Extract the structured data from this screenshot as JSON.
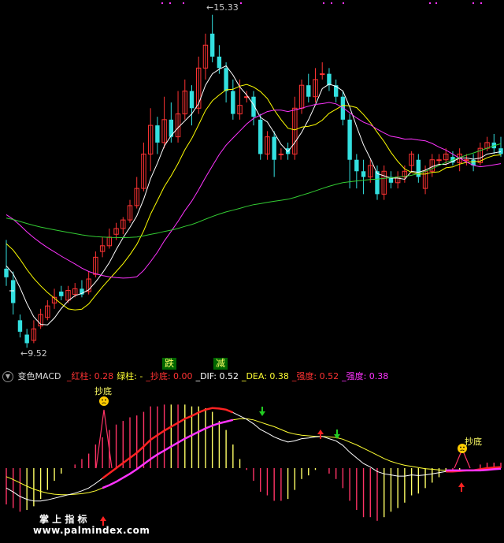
{
  "main_chart": {
    "price_high_label": "15.33",
    "price_low_label": "9.52",
    "signal_die": "跌",
    "signal_jian": "减"
  },
  "macd_panel": {
    "toggle_icon": "chevron-down-icon",
    "name": "变色MACD",
    "legend": [
      {
        "text": "_红柱: 0.28",
        "color": "#ff3333"
      },
      {
        "text": "绿柱: -",
        "color": "#ffff33"
      },
      {
        "text": "_抄底: 0.00",
        "color": "#ff3333"
      },
      {
        "text": "_DIF: 0.52",
        "color": "#ffffff"
      },
      {
        "text": "_DEA: 0.38",
        "color": "#ffff33"
      },
      {
        "text": "_强度: 0.52",
        "color": "#ff3333"
      },
      {
        "text": "_强度: 0.38",
        "color": "#ff33ff"
      }
    ],
    "chaodi_label_1": "抄底",
    "chaodi_label_2": "抄底",
    "watermark_title": "掌 上 指 标",
    "watermark_url": "www.palmindex.com"
  },
  "chart_data": {
    "type": "candlestick",
    "price_max": 15.33,
    "price_min": 9.52,
    "candles": [
      [
        10.9,
        10.75,
        11.4,
        10.6
      ],
      [
        10.7,
        10.3,
        10.85,
        10.1
      ],
      [
        10.0,
        9.8,
        10.1,
        9.7
      ],
      [
        9.75,
        9.6,
        9.85,
        9.52
      ],
      [
        9.65,
        9.85,
        10.0,
        9.6
      ],
      [
        9.9,
        10.1,
        10.2,
        9.85
      ],
      [
        10.05,
        10.25,
        10.35,
        10.0
      ],
      [
        10.3,
        10.4,
        10.55,
        10.2
      ],
      [
        10.5,
        10.42,
        10.6,
        10.35
      ],
      [
        10.35,
        10.52,
        10.6,
        10.3
      ],
      [
        10.45,
        10.55,
        10.65,
        10.4
      ],
      [
        10.55,
        10.45,
        10.7,
        10.4
      ],
      [
        10.5,
        10.72,
        10.85,
        10.45
      ],
      [
        10.8,
        11.1,
        11.2,
        10.75
      ],
      [
        11.2,
        11.3,
        11.45,
        11.1
      ],
      [
        11.3,
        11.45,
        11.6,
        11.25
      ],
      [
        11.5,
        11.6,
        11.7,
        11.4
      ],
      [
        11.6,
        11.75,
        11.8,
        11.5
      ],
      [
        11.75,
        12.0,
        12.1,
        11.7
      ],
      [
        12.0,
        12.3,
        12.5,
        11.95
      ],
      [
        12.3,
        12.9,
        13.1,
        12.25
      ],
      [
        12.9,
        13.4,
        13.7,
        12.6
      ],
      [
        13.4,
        13.1,
        13.55,
        12.9
      ],
      [
        13.1,
        13.5,
        13.9,
        13.0
      ],
      [
        13.5,
        13.2,
        13.8,
        13.1
      ],
      [
        13.2,
        13.6,
        14.0,
        13.1
      ],
      [
        13.6,
        14.0,
        14.2,
        13.5
      ],
      [
        14.0,
        13.7,
        14.1,
        13.4
      ],
      [
        13.7,
        14.4,
        14.6,
        13.6
      ],
      [
        14.4,
        14.8,
        15.0,
        14.2
      ],
      [
        15.0,
        14.6,
        15.33,
        14.5
      ],
      [
        14.6,
        14.4,
        14.8,
        14.3
      ],
      [
        14.4,
        14.0,
        14.5,
        13.8
      ],
      [
        14.0,
        13.6,
        14.2,
        13.5
      ],
      [
        13.6,
        13.75,
        14.2,
        13.5
      ],
      [
        13.9,
        13.9,
        14.0,
        13.8
      ],
      [
        13.9,
        13.55,
        14.0,
        13.4
      ],
      [
        13.5,
        12.9,
        13.6,
        12.8
      ],
      [
        12.9,
        13.2,
        13.3,
        12.8
      ],
      [
        13.2,
        12.8,
        13.3,
        12.5
      ],
      [
        12.9,
        12.9,
        13.0,
        12.8
      ],
      [
        13.0,
        12.9,
        13.1,
        12.8
      ],
      [
        12.9,
        13.7,
        13.9,
        12.8
      ],
      [
        13.7,
        14.1,
        14.2,
        13.6
      ],
      [
        14.1,
        13.9,
        14.3,
        13.8
      ],
      [
        13.9,
        14.2,
        14.4,
        13.8
      ],
      [
        14.3,
        14.3,
        14.5,
        14.2
      ],
      [
        14.3,
        14.1,
        14.4,
        14.0
      ],
      [
        14.1,
        13.9,
        14.2,
        13.8
      ],
      [
        13.9,
        13.5,
        14.0,
        13.4
      ],
      [
        13.5,
        12.8,
        13.6,
        12.3
      ],
      [
        12.8,
        12.6,
        12.9,
        12.3
      ],
      [
        12.6,
        12.5,
        12.8,
        12.2
      ],
      [
        12.5,
        12.7,
        12.8,
        12.4
      ],
      [
        12.6,
        12.2,
        12.7,
        12.1
      ],
      [
        12.2,
        12.6,
        12.7,
        12.1
      ],
      [
        12.5,
        12.4,
        12.6,
        12.3
      ],
      [
        12.4,
        12.5,
        12.6,
        12.3
      ],
      [
        12.5,
        12.6,
        12.7,
        12.4
      ],
      [
        12.7,
        12.9,
        12.95,
        12.6
      ],
      [
        12.8,
        12.5,
        12.9,
        12.4
      ],
      [
        12.3,
        12.6,
        12.7,
        12.2
      ],
      [
        12.6,
        12.8,
        12.9,
        12.5
      ],
      [
        12.8,
        12.8,
        12.9,
        12.7
      ],
      [
        12.8,
        12.9,
        13.0,
        12.7
      ],
      [
        12.85,
        12.75,
        12.95,
        12.7
      ],
      [
        12.75,
        12.9,
        13.0,
        12.6
      ],
      [
        12.8,
        12.8,
        12.9,
        12.7
      ],
      [
        12.8,
        12.7,
        12.9,
        12.6
      ],
      [
        12.75,
        13.0,
        13.1,
        12.7
      ],
      [
        13.0,
        13.1,
        13.2,
        12.95
      ],
      [
        13.1,
        13.0,
        13.25,
        12.9
      ],
      [
        13.0,
        12.9,
        13.2,
        12.85
      ]
    ],
    "ma_lines": [
      {
        "name": "MA5",
        "color": "#ffffff"
      },
      {
        "name": "MA10",
        "color": "#ffff00"
      },
      {
        "name": "MA20",
        "color": "#ff33ff"
      },
      {
        "name": "MA60",
        "color": "#33cc33"
      }
    ],
    "macd": {
      "dif": [
        -0.35,
        -0.42,
        -0.5,
        -0.55,
        -0.58,
        -0.58,
        -0.56,
        -0.53,
        -0.5,
        -0.47,
        -0.44,
        -0.4,
        -0.35,
        -0.27,
        -0.18,
        -0.09,
        0.0,
        0.09,
        0.18,
        0.27,
        0.38,
        0.5,
        0.58,
        0.66,
        0.73,
        0.8,
        0.87,
        0.92,
        0.98,
        1.03,
        1.06,
        1.05,
        1.03,
        0.98,
        0.92,
        0.86,
        0.78,
        0.68,
        0.62,
        0.55,
        0.5,
        0.46,
        0.48,
        0.52,
        0.53,
        0.55,
        0.56,
        0.52,
        0.48,
        0.4,
        0.28,
        0.18,
        0.08,
        0.02,
        -0.06,
        -0.1,
        -0.12,
        -0.14,
        -0.14,
        -0.12,
        -0.13,
        -0.12,
        -0.1,
        -0.08,
        -0.06,
        -0.06,
        -0.05,
        -0.04,
        -0.04,
        -0.02,
        0.0,
        0.01,
        0.02
      ],
      "dea": [
        -0.15,
        -0.2,
        -0.26,
        -0.32,
        -0.37,
        -0.41,
        -0.44,
        -0.46,
        -0.47,
        -0.47,
        -0.46,
        -0.45,
        -0.43,
        -0.4,
        -0.35,
        -0.3,
        -0.24,
        -0.17,
        -0.1,
        -0.02,
        0.07,
        0.16,
        0.24,
        0.31,
        0.38,
        0.45,
        0.52,
        0.58,
        0.64,
        0.7,
        0.75,
        0.79,
        0.82,
        0.85,
        0.87,
        0.87,
        0.85,
        0.81,
        0.77,
        0.73,
        0.68,
        0.63,
        0.6,
        0.58,
        0.57,
        0.56,
        0.56,
        0.55,
        0.54,
        0.51,
        0.46,
        0.41,
        0.35,
        0.29,
        0.23,
        0.17,
        0.12,
        0.08,
        0.05,
        0.03,
        0.01,
        -0.01,
        -0.02,
        -0.03,
        -0.04,
        -0.04,
        -0.04,
        -0.04,
        -0.04,
        -0.04,
        -0.03,
        -0.02,
        -0.01
      ]
    }
  }
}
